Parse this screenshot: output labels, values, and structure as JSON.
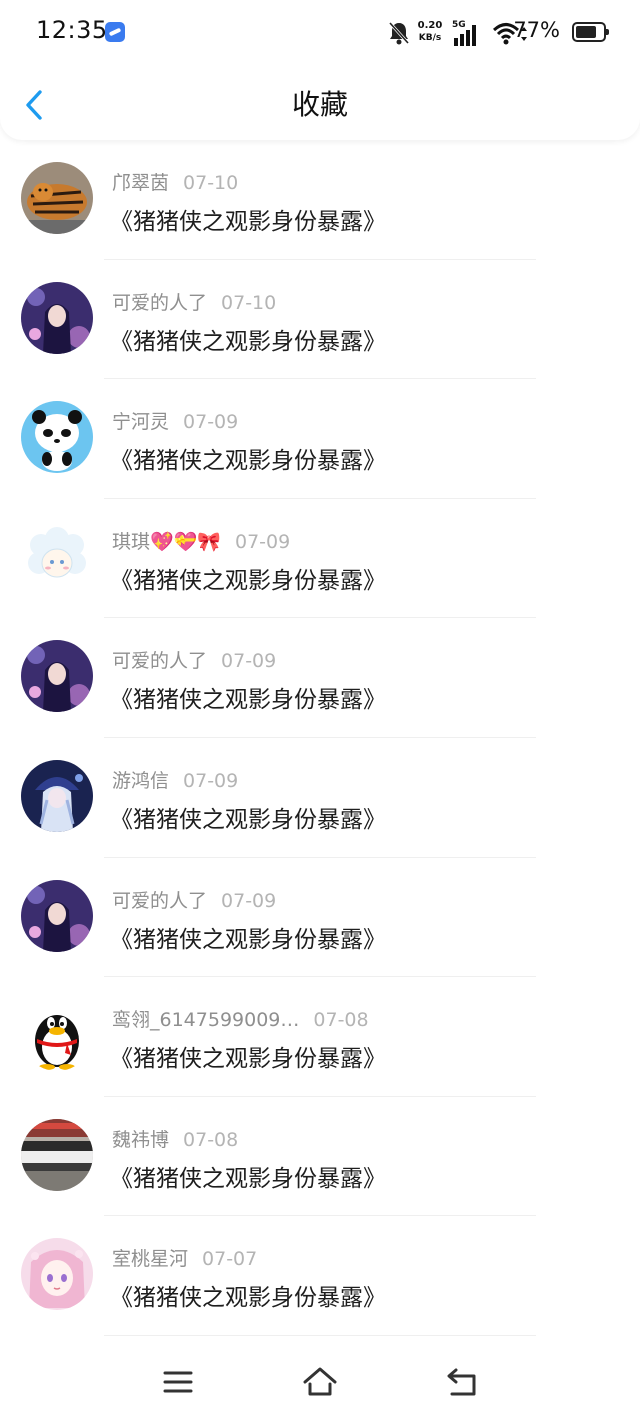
{
  "status": {
    "time": "12:35",
    "net_speed_value": "0.20",
    "net_speed_unit": "KB/s",
    "network_type": "5G",
    "battery_percent": "77%",
    "battery_level": 0.77
  },
  "header": {
    "title": "收藏",
    "back_icon": "chevron-left-icon"
  },
  "favorites": [
    {
      "user": "邝翠茵",
      "date": "07-10",
      "title": "《猪猪侠之观影身份暴露》",
      "avatar": "tiger"
    },
    {
      "user": "可爱的人了",
      "date": "07-10",
      "title": "《猪猪侠之观影身份暴露》",
      "avatar": "anime-purple"
    },
    {
      "user": "宁河灵",
      "date": "07-09",
      "title": "《猪猪侠之观影身份暴露》",
      "avatar": "panda"
    },
    {
      "user": "琪琪💖💝🎀",
      "date": "07-09",
      "title": "《猪猪侠之观影身份暴露》",
      "avatar": "sheep"
    },
    {
      "user": "可爱的人了",
      "date": "07-09",
      "title": "《猪猪侠之观影身份暴露》",
      "avatar": "anime-purple"
    },
    {
      "user": "游鸿信",
      "date": "07-09",
      "title": "《猪猪侠之观影身份暴露》",
      "avatar": "anime-white"
    },
    {
      "user": "可爱的人了",
      "date": "07-09",
      "title": "《猪猪侠之观影身份暴露》",
      "avatar": "anime-purple"
    },
    {
      "user": "鸾翎_6147599009…",
      "date": "07-08",
      "title": "《猪猪侠之观影身份暴露》",
      "avatar": "penguin"
    },
    {
      "user": "魏祎博",
      "date": "07-08",
      "title": "《猪猪侠之观影身份暴露》",
      "avatar": "group-photo"
    },
    {
      "user": "室桃星河",
      "date": "07-07",
      "title": "《猪猪侠之观影身份暴露》",
      "avatar": "anime-pink"
    }
  ],
  "bottom_nav": {
    "menu_icon": "menu-icon",
    "home_icon": "home-icon",
    "back_icon": "return-icon"
  },
  "colors": {
    "accent": "#1e9bef",
    "meta_text": "#8f8f8f",
    "date_text": "#b4b4b4",
    "title_text": "#1e1e1e"
  }
}
